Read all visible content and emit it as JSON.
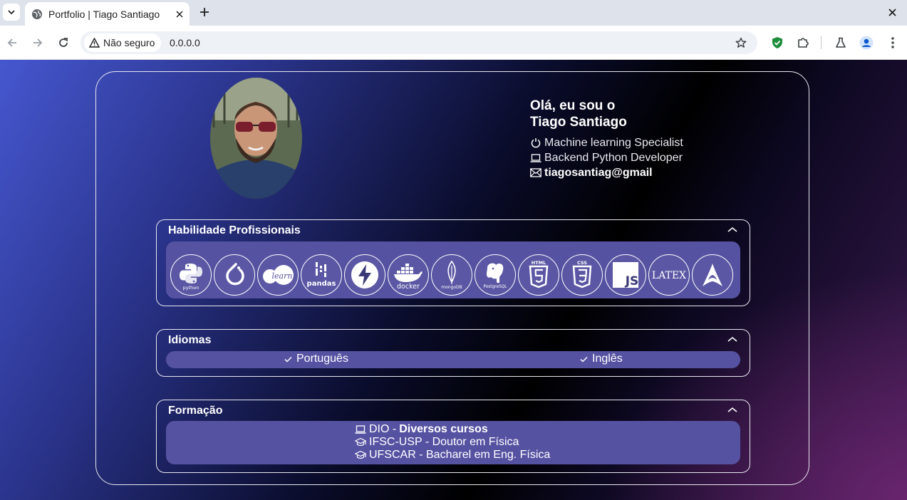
{
  "browser": {
    "tab_title": "Portfolio | Tiago Santiago",
    "security_label": "Não seguro",
    "url": "0.0.0.0"
  },
  "profile": {
    "greeting": "Olá, eu sou o",
    "name": "Tiago Santiago",
    "roles": [
      {
        "icon": "power-icon",
        "text": "Machine learning Specialist"
      },
      {
        "icon": "laptop-icon",
        "text": "Backend Python Developer"
      }
    ],
    "email": "tiagosantiag@gmail"
  },
  "skills": {
    "title": "Habilidade Profissionais",
    "items": [
      {
        "name": "python",
        "label": "python"
      },
      {
        "name": "pytorch",
        "label": ""
      },
      {
        "name": "scikit-learn",
        "label": "learn"
      },
      {
        "name": "pandas",
        "label": "pandas"
      },
      {
        "name": "fastapi",
        "label": ""
      },
      {
        "name": "docker",
        "label": "docker"
      },
      {
        "name": "mongodb",
        "label": "mongoDB"
      },
      {
        "name": "postgresql",
        "label": "PostgreSQL"
      },
      {
        "name": "html5",
        "label": "HTML"
      },
      {
        "name": "css3",
        "label": "CSS"
      },
      {
        "name": "javascript",
        "label": "JS"
      },
      {
        "name": "latex",
        "label": "LATEX"
      },
      {
        "name": "arch-linux",
        "label": ""
      }
    ]
  },
  "languages": {
    "title": "Idiomas",
    "items": [
      "Português",
      "Inglês"
    ]
  },
  "education": {
    "title": "Formação",
    "items": [
      {
        "icon": "laptop-icon",
        "text": "DIO -",
        "bold": "Diversos cursos"
      },
      {
        "icon": "graduation-cap-icon",
        "text": "IFSC-USP - Doutor em Física",
        "bold": ""
      },
      {
        "icon": "graduation-cap-icon",
        "text": "UFSCAR - Bacharel em Eng. Física",
        "bold": ""
      }
    ]
  }
}
